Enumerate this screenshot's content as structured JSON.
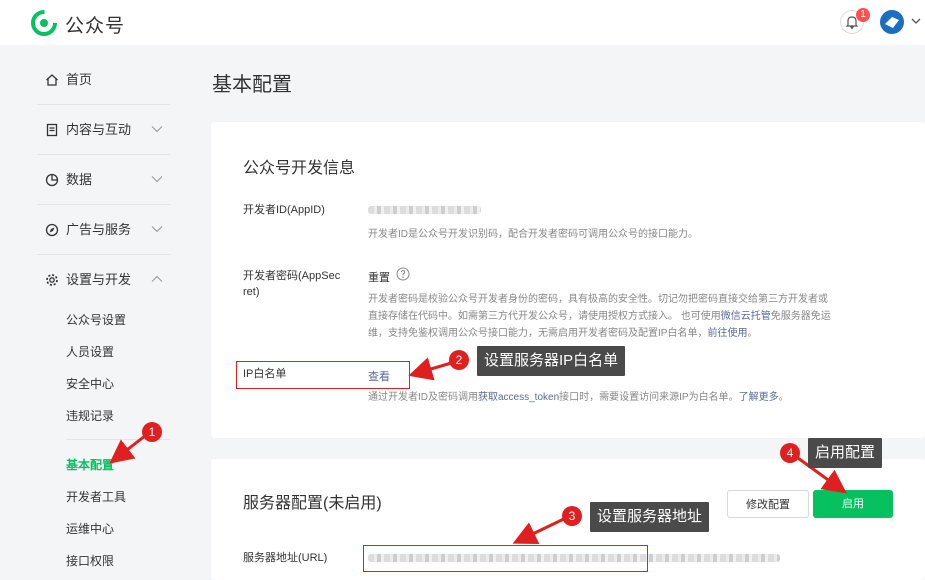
{
  "header": {
    "brand": "公众号",
    "notification_count": "1"
  },
  "sidebar": {
    "groups": [
      {
        "label": "首页",
        "icon": "home-icon"
      },
      {
        "label": "内容与互动",
        "icon": "document-icon"
      },
      {
        "label": "数据",
        "icon": "pie-chart-icon"
      },
      {
        "label": "广告与服务",
        "icon": "compass-icon"
      },
      {
        "label": "设置与开发",
        "icon": "gear-icon"
      }
    ],
    "sub_items": [
      "公众号设置",
      "人员设置",
      "安全中心",
      "违规记录",
      "基本配置",
      "开发者工具",
      "运维中心",
      "接口权限"
    ],
    "active_item": "基本配置"
  },
  "main": {
    "title": "基本配置",
    "dev_info": {
      "title": "公众号开发信息",
      "appid_label": "开发者ID(AppID)",
      "appid_desc": "开发者ID是公众号开发识别码，配合开发者密码可调用公众号的接口能力。",
      "secret_label_1": "开发者密码(AppSec",
      "secret_label_2": "ret)",
      "reset_label": "重置",
      "secret_desc_1": "开发者密码是校验公众号开发者身份的密码，具有极高的安全性。切记勿把密码直接交给第三方开发者或",
      "secret_desc_2": "直接存储在代码中。如需第三方代开发公众号，请使用授权方式接入。 也可使用",
      "secret_desc_2_link": "微信云托管",
      "secret_desc_2_tail": "免服务器免运",
      "secret_desc_3": "维，支持免鉴权调用公众号接口能力，无需启用开发者密码及配置IP白名单，",
      "secret_desc_3_link": "前往使用",
      "secret_desc_3_tail": "。",
      "ip_label": "IP白名单",
      "ip_view": "查看",
      "ip_desc_1": "通过开发者ID及密码调用",
      "ip_desc_link1": "获取access_token",
      "ip_desc_2": "接口时，需要设置访问来源IP为白名单。",
      "ip_desc_link2": "了解更多",
      "ip_desc_3": "。"
    },
    "server_config": {
      "title": "服务器配置(未启用)",
      "modify_button": "修改配置",
      "enable_button": "启用",
      "url_label": "服务器地址(URL)"
    }
  },
  "annotations": [
    {
      "num": "1",
      "text": ""
    },
    {
      "num": "2",
      "text": "设置服务器IP白名单"
    },
    {
      "num": "3",
      "text": "设置服务器地址"
    },
    {
      "num": "4",
      "text": "启用配置"
    }
  ],
  "colors": {
    "accent": "#07c160",
    "annotation": "#e02020",
    "callout_bg": "#4a4a4a",
    "link": "#576b95"
  }
}
